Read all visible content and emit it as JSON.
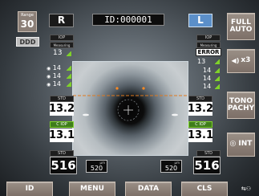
{
  "header": {
    "range_label": "Range",
    "range_value": "30",
    "ddd_label": "DDD",
    "eye_r": "R",
    "id_text": "ID:000001",
    "eye_l": "L",
    "full_auto": "FULL AUTO"
  },
  "right_panel": {
    "buzzer_label": "x3",
    "tono_pachy": "TONO PACHY",
    "int_label": "INT"
  },
  "left_column": {
    "iop_label": "IOP",
    "meas_label": "Measuring",
    "iop_value": "13",
    "readings": [
      "14",
      "14",
      "14"
    ],
    "std_label": "STD",
    "std_value": "13.2",
    "c_iop_label": "C IOP",
    "c_iop_value": "13.1",
    "std2_label": "STD",
    "pachy_value": "516",
    "pachy_sub": "520",
    "pachy_unit": "µm"
  },
  "right_column": {
    "iop_label": "IOP",
    "meas_label": "Measuring",
    "error_text": "ERROR",
    "iop_value": "13",
    "readings": [
      "14",
      "14",
      "14"
    ],
    "std_label": "STD",
    "std_value": "13.2",
    "c_iop_label": "C IOP",
    "c_iop_value": "13.1",
    "std2_label": "STD",
    "pachy_value": "516",
    "pachy_sub": "520",
    "pachy_unit": "µm"
  },
  "bottom_bar": {
    "id": "ID",
    "menu": "MENU",
    "data": "DATA",
    "cls": "CLS"
  },
  "colors": {
    "button_fill": "#8b7f77",
    "highlight_green": "#7fd12a",
    "eye_badge_blue": "#5b8fc9",
    "alignment_line": "#e07a1f"
  }
}
